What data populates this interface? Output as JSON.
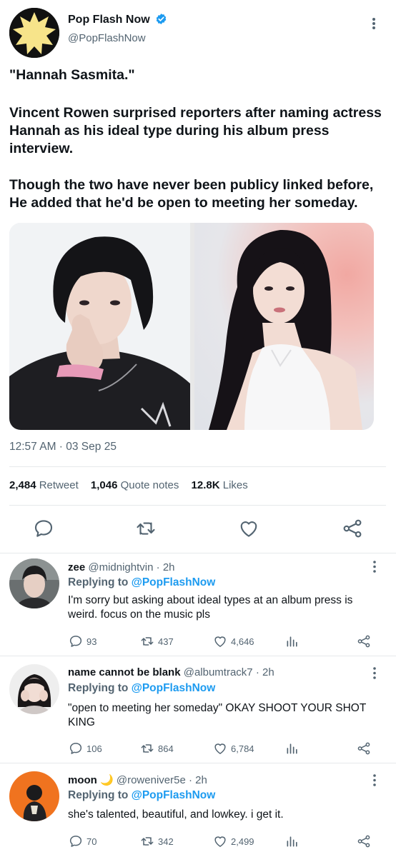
{
  "tweet": {
    "display_name": "Pop Flash Now",
    "handle": "@PopFlashNow",
    "verified": true,
    "text_lines": [
      "\"Hannah Sasmita.\"",
      "Vincent Rowen surprised reporters after naming actress Hannah as his ideal type during his album press interview.",
      "Though the two have never been publicy linked before, He added that he'd be open to meeting her someday."
    ],
    "timestamp": "12:57 AM · 03 Sep 25",
    "stats": [
      {
        "value": "2,484",
        "label": "Retweet"
      },
      {
        "value": "1,046",
        "label": "Quote notes"
      },
      {
        "value": "12.8K",
        "label": "Likes"
      }
    ],
    "actions": [
      "reply-icon",
      "retweet-icon",
      "like-icon",
      "share-icon"
    ]
  },
  "replies": [
    {
      "name": "zee",
      "handle": "@midnightvin",
      "time": "2h",
      "replying_label": "Replying to",
      "replying_to": "@PopFlashNow",
      "text": "I'm sorry but asking about ideal types at an album press is weird. focus on the music pls",
      "replies": "93",
      "retweets": "437",
      "likes": "4,646"
    },
    {
      "name": "name cannot be blank",
      "handle": "@albumtrack7",
      "time": "2h",
      "replying_label": "Replying to",
      "replying_to": "@PopFlashNow",
      "text": "\"open to meeting her someday\" OKAY SHOOT YOUR SHOT KING",
      "replies": "106",
      "retweets": "864",
      "likes": "6,784"
    },
    {
      "name": "moon",
      "name_emoji": "🌙",
      "handle": "@roweniver5e",
      "time": "2h",
      "replying_label": "Replying to",
      "replying_to": "@PopFlashNow",
      "text": "she's talented, beautiful, and lowkey. i get it.",
      "replies": "70",
      "retweets": "342",
      "likes": "2,499"
    }
  ],
  "colors": {
    "accent": "#1d9bf0",
    "secondary_text": "#536471",
    "primary_text": "#0f1419",
    "divider": "#e6e9eb"
  }
}
